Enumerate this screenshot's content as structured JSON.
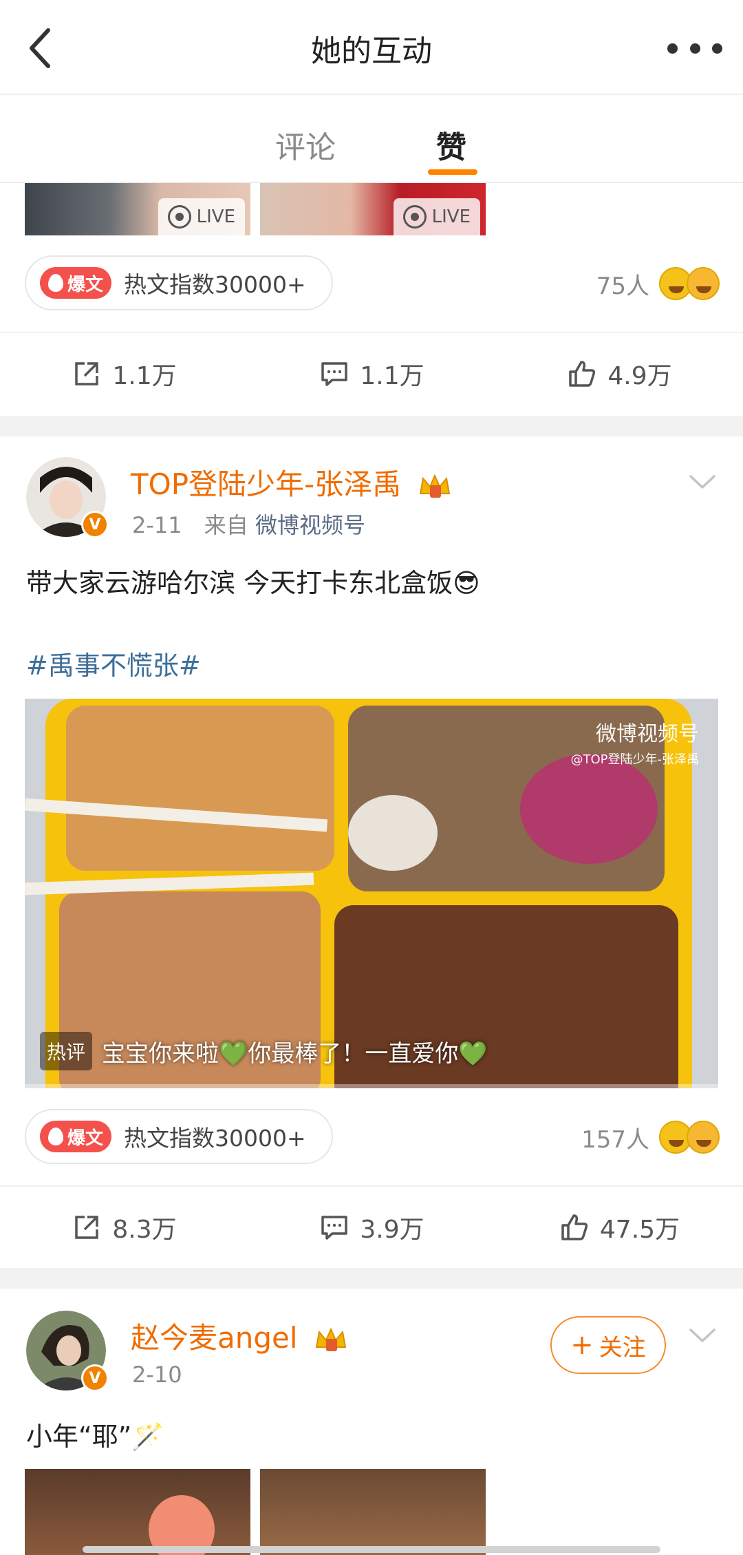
{
  "header": {
    "title": "她的互动"
  },
  "tabs": [
    {
      "label": "评论",
      "active": false
    },
    {
      "label": "赞",
      "active": true
    }
  ],
  "colors": {
    "accent": "#ff8200",
    "username": "#f06c00",
    "hashtag": "#3d6e98",
    "hot_badge": "#f4514c"
  },
  "post1": {
    "thumbnails": [
      {
        "badge": "LIVE"
      },
      {
        "badge": "LIVE"
      }
    ],
    "hot": {
      "badge": "爆文",
      "text": "热文指数30000+"
    },
    "likers": "75人",
    "actions": {
      "repost": "1.1万",
      "comment": "1.1万",
      "like": "4.9万"
    }
  },
  "post2": {
    "username": "TOP登陆少年-张泽禹",
    "date": "2-11",
    "source_prefix": "来自",
    "source": "微博视频号",
    "text": "带大家云游哈尔滨 今天打卡东北盒饭😎",
    "hashtag": "#禹事不慌张#",
    "video": {
      "watermark": "微博视频号",
      "watermark_sub": "@TOP登陆少年-张泽禹",
      "hot_comment_tag": "热评",
      "hot_comment": "宝宝你来啦💚你最棒了！一直爱你💚"
    },
    "hot": {
      "badge": "爆文",
      "text": "热文指数30000+"
    },
    "likers": "157人",
    "actions": {
      "repost": "8.3万",
      "comment": "3.9万",
      "like": "47.5万"
    }
  },
  "post3": {
    "username": "赵今麦angel",
    "date": "2-10",
    "follow_label": "关注",
    "text": "小年“耶”🪄"
  }
}
